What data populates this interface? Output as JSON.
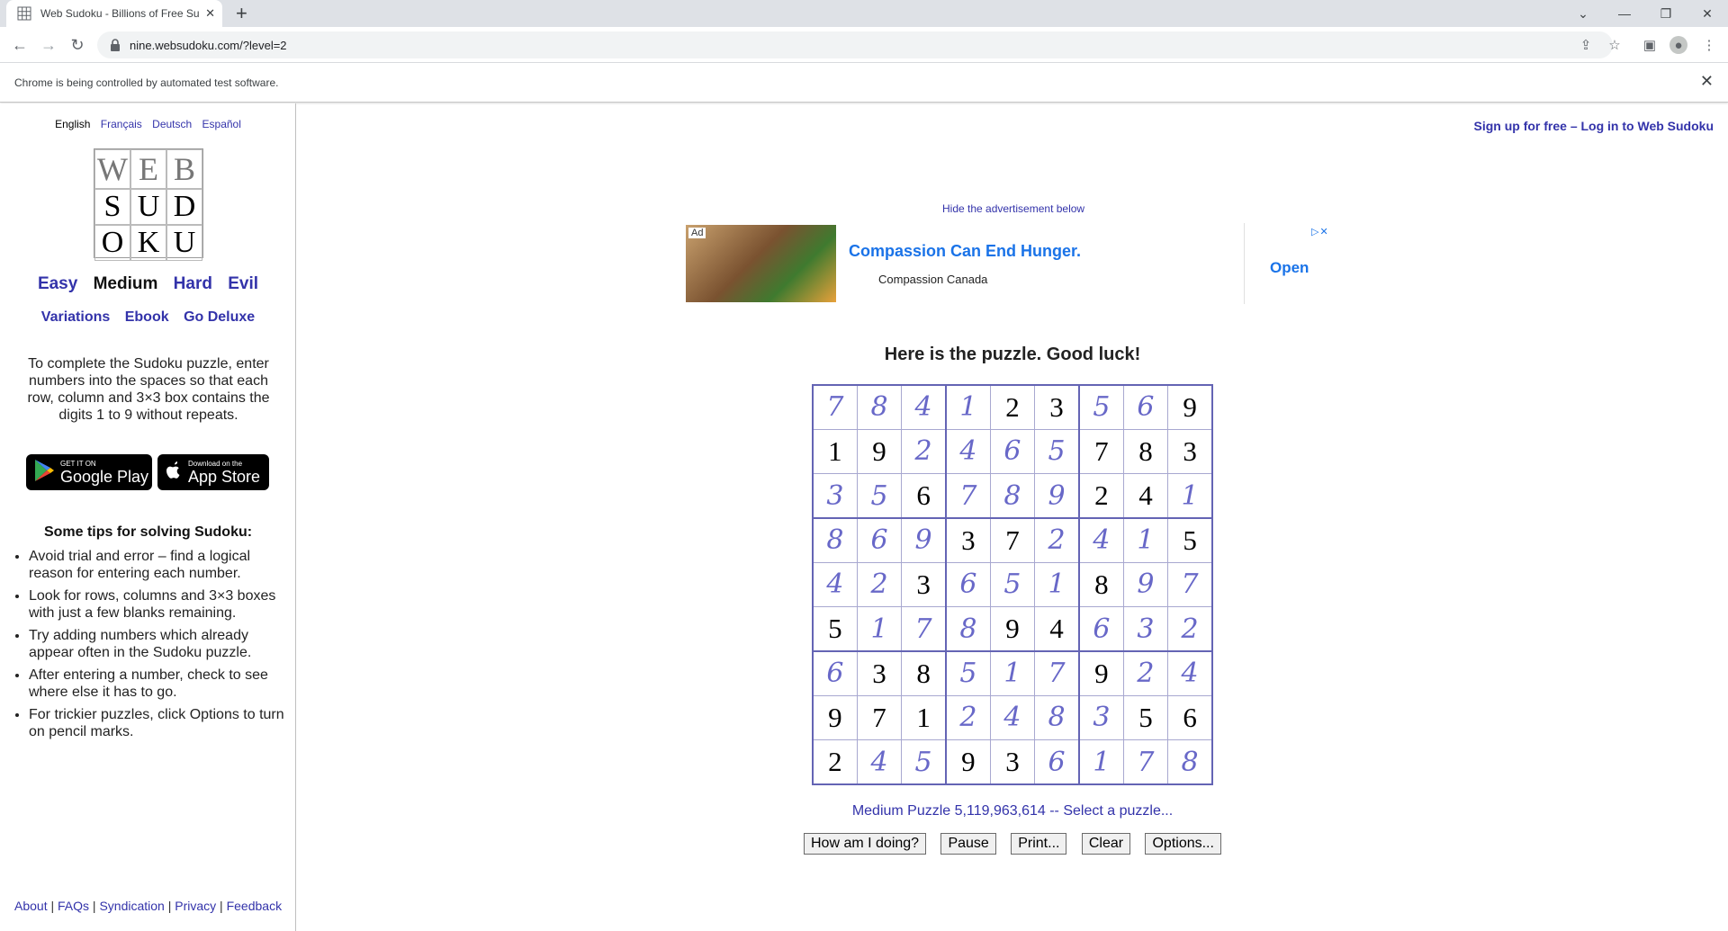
{
  "browser": {
    "tab_title": "Web Sudoku - Billions of Free Su",
    "tab_close": "✕",
    "new_tab": "+",
    "url": "nine.websudoku.com/?level=2",
    "automation_message": "Chrome is being controlled by automated test software.",
    "infobar_close": "✕"
  },
  "sidebar": {
    "languages": [
      "English",
      "Français",
      "Deutsch",
      "Español"
    ],
    "logo": [
      "W",
      "E",
      "B",
      "S",
      "U",
      "D",
      "O",
      "K",
      "U"
    ],
    "levels": [
      "Easy",
      "Medium",
      "Hard",
      "Evil"
    ],
    "extras": [
      "Variations",
      "Ebook",
      "Go Deluxe"
    ],
    "intro": "To complete the Sudoku puzzle, enter numbers into the spaces so that each row, column and 3×3 box contains the digits 1 to 9 without repeats.",
    "google_play": {
      "small": "GET IT ON",
      "big": "Google Play"
    },
    "app_store": {
      "small": "Download on the",
      "big": "App Store"
    },
    "tips_title": "Some tips for solving Sudoku:",
    "tips": [
      "Avoid trial and error – find a logical reason for entering each number.",
      "Look for rows, columns and 3×3 boxes with just a few blanks remaining.",
      "Try adding numbers which already appear often in the Sudoku puzzle.",
      "After entering a number, check to see where else it has to go.",
      "For trickier puzzles, click Options to turn on pencil marks."
    ],
    "footer": [
      "About",
      "FAQs",
      "Syndication",
      "Privacy",
      "Feedback"
    ]
  },
  "main": {
    "signup": "Sign up for free – Log in to Web Sudoku",
    "hide_ad": "Hide the advertisement below",
    "ad": {
      "tag": "Ad",
      "headline": "Compassion Can End Hunger.",
      "sponsor": "Compassion Canada",
      "cta": "Open",
      "choices": "▷✕"
    },
    "puzzle_title": "Here is the puzzle. Good luck!",
    "puzzle_info": "Medium Puzzle 5,119,963,614 -- Select a puzzle...",
    "buttons": [
      "How am I doing?",
      "Pause",
      "Print...",
      "Clear",
      "Options..."
    ]
  },
  "sudoku": {
    "cells": [
      [
        {
          "v": "7",
          "g": false
        },
        {
          "v": "8",
          "g": false
        },
        {
          "v": "4",
          "g": false
        },
        {
          "v": "1",
          "g": false
        },
        {
          "v": "2",
          "g": true
        },
        {
          "v": "3",
          "g": true
        },
        {
          "v": "5",
          "g": false
        },
        {
          "v": "6",
          "g": false
        },
        {
          "v": "9",
          "g": true
        }
      ],
      [
        {
          "v": "1",
          "g": true
        },
        {
          "v": "9",
          "g": true
        },
        {
          "v": "2",
          "g": false
        },
        {
          "v": "4",
          "g": false
        },
        {
          "v": "6",
          "g": false
        },
        {
          "v": "5",
          "g": false
        },
        {
          "v": "7",
          "g": true
        },
        {
          "v": "8",
          "g": true
        },
        {
          "v": "3",
          "g": true
        }
      ],
      [
        {
          "v": "3",
          "g": false
        },
        {
          "v": "5",
          "g": false
        },
        {
          "v": "6",
          "g": true
        },
        {
          "v": "7",
          "g": false
        },
        {
          "v": "8",
          "g": false
        },
        {
          "v": "9",
          "g": false
        },
        {
          "v": "2",
          "g": true
        },
        {
          "v": "4",
          "g": true
        },
        {
          "v": "1",
          "g": false
        }
      ],
      [
        {
          "v": "8",
          "g": false
        },
        {
          "v": "6",
          "g": false
        },
        {
          "v": "9",
          "g": false
        },
        {
          "v": "3",
          "g": true
        },
        {
          "v": "7",
          "g": true
        },
        {
          "v": "2",
          "g": false
        },
        {
          "v": "4",
          "g": false
        },
        {
          "v": "1",
          "g": false
        },
        {
          "v": "5",
          "g": true
        }
      ],
      [
        {
          "v": "4",
          "g": false
        },
        {
          "v": "2",
          "g": false
        },
        {
          "v": "3",
          "g": true
        },
        {
          "v": "6",
          "g": false
        },
        {
          "v": "5",
          "g": false
        },
        {
          "v": "1",
          "g": false
        },
        {
          "v": "8",
          "g": true
        },
        {
          "v": "9",
          "g": false
        },
        {
          "v": "7",
          "g": false
        }
      ],
      [
        {
          "v": "5",
          "g": true
        },
        {
          "v": "1",
          "g": false
        },
        {
          "v": "7",
          "g": false
        },
        {
          "v": "8",
          "g": false
        },
        {
          "v": "9",
          "g": true
        },
        {
          "v": "4",
          "g": true
        },
        {
          "v": "6",
          "g": false
        },
        {
          "v": "3",
          "g": false
        },
        {
          "v": "2",
          "g": false
        }
      ],
      [
        {
          "v": "6",
          "g": false
        },
        {
          "v": "3",
          "g": true
        },
        {
          "v": "8",
          "g": true
        },
        {
          "v": "5",
          "g": false
        },
        {
          "v": "1",
          "g": false
        },
        {
          "v": "7",
          "g": false
        },
        {
          "v": "9",
          "g": true
        },
        {
          "v": "2",
          "g": false
        },
        {
          "v": "4",
          "g": false
        }
      ],
      [
        {
          "v": "9",
          "g": true
        },
        {
          "v": "7",
          "g": true
        },
        {
          "v": "1",
          "g": true
        },
        {
          "v": "2",
          "g": false
        },
        {
          "v": "4",
          "g": false
        },
        {
          "v": "8",
          "g": false
        },
        {
          "v": "3",
          "g": false
        },
        {
          "v": "5",
          "g": true
        },
        {
          "v": "6",
          "g": true
        }
      ],
      [
        {
          "v": "2",
          "g": true
        },
        {
          "v": "4",
          "g": false
        },
        {
          "v": "5",
          "g": false
        },
        {
          "v": "9",
          "g": true
        },
        {
          "v": "3",
          "g": true
        },
        {
          "v": "6",
          "g": false
        },
        {
          "v": "1",
          "g": false
        },
        {
          "v": "7",
          "g": false
        },
        {
          "v": "8",
          "g": false
        }
      ]
    ]
  },
  "colors": {
    "link": "#3333aa",
    "user_digit": "#6868c8",
    "grid_border": "#6464b4",
    "ad_blue": "#1a73e8"
  }
}
